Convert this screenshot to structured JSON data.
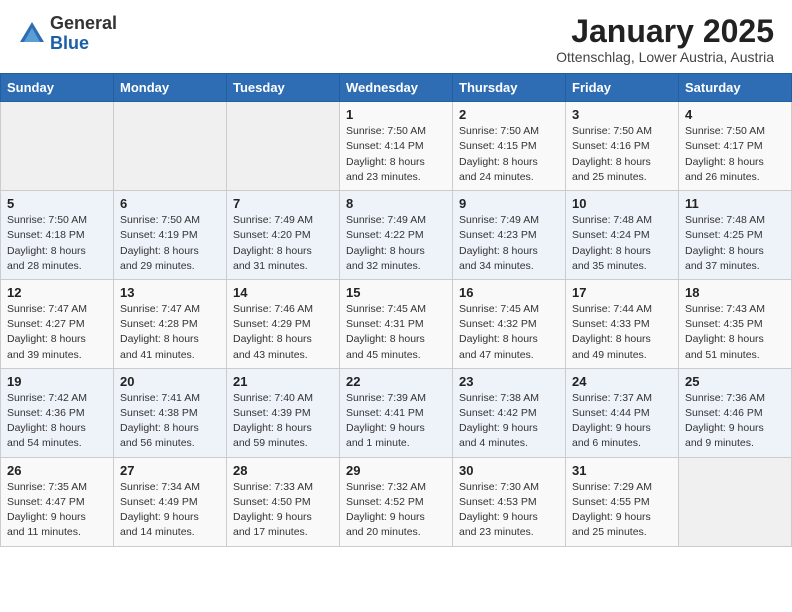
{
  "header": {
    "logo_general": "General",
    "logo_blue": "Blue",
    "month_title": "January 2025",
    "subtitle": "Ottenschlag, Lower Austria, Austria"
  },
  "days_of_week": [
    "Sunday",
    "Monday",
    "Tuesday",
    "Wednesday",
    "Thursday",
    "Friday",
    "Saturday"
  ],
  "weeks": [
    [
      {
        "day": "",
        "info": ""
      },
      {
        "day": "",
        "info": ""
      },
      {
        "day": "",
        "info": ""
      },
      {
        "day": "1",
        "info": "Sunrise: 7:50 AM\nSunset: 4:14 PM\nDaylight: 8 hours\nand 23 minutes."
      },
      {
        "day": "2",
        "info": "Sunrise: 7:50 AM\nSunset: 4:15 PM\nDaylight: 8 hours\nand 24 minutes."
      },
      {
        "day": "3",
        "info": "Sunrise: 7:50 AM\nSunset: 4:16 PM\nDaylight: 8 hours\nand 25 minutes."
      },
      {
        "day": "4",
        "info": "Sunrise: 7:50 AM\nSunset: 4:17 PM\nDaylight: 8 hours\nand 26 minutes."
      }
    ],
    [
      {
        "day": "5",
        "info": "Sunrise: 7:50 AM\nSunset: 4:18 PM\nDaylight: 8 hours\nand 28 minutes."
      },
      {
        "day": "6",
        "info": "Sunrise: 7:50 AM\nSunset: 4:19 PM\nDaylight: 8 hours\nand 29 minutes."
      },
      {
        "day": "7",
        "info": "Sunrise: 7:49 AM\nSunset: 4:20 PM\nDaylight: 8 hours\nand 31 minutes."
      },
      {
        "day": "8",
        "info": "Sunrise: 7:49 AM\nSunset: 4:22 PM\nDaylight: 8 hours\nand 32 minutes."
      },
      {
        "day": "9",
        "info": "Sunrise: 7:49 AM\nSunset: 4:23 PM\nDaylight: 8 hours\nand 34 minutes."
      },
      {
        "day": "10",
        "info": "Sunrise: 7:48 AM\nSunset: 4:24 PM\nDaylight: 8 hours\nand 35 minutes."
      },
      {
        "day": "11",
        "info": "Sunrise: 7:48 AM\nSunset: 4:25 PM\nDaylight: 8 hours\nand 37 minutes."
      }
    ],
    [
      {
        "day": "12",
        "info": "Sunrise: 7:47 AM\nSunset: 4:27 PM\nDaylight: 8 hours\nand 39 minutes."
      },
      {
        "day": "13",
        "info": "Sunrise: 7:47 AM\nSunset: 4:28 PM\nDaylight: 8 hours\nand 41 minutes."
      },
      {
        "day": "14",
        "info": "Sunrise: 7:46 AM\nSunset: 4:29 PM\nDaylight: 8 hours\nand 43 minutes."
      },
      {
        "day": "15",
        "info": "Sunrise: 7:45 AM\nSunset: 4:31 PM\nDaylight: 8 hours\nand 45 minutes."
      },
      {
        "day": "16",
        "info": "Sunrise: 7:45 AM\nSunset: 4:32 PM\nDaylight: 8 hours\nand 47 minutes."
      },
      {
        "day": "17",
        "info": "Sunrise: 7:44 AM\nSunset: 4:33 PM\nDaylight: 8 hours\nand 49 minutes."
      },
      {
        "day": "18",
        "info": "Sunrise: 7:43 AM\nSunset: 4:35 PM\nDaylight: 8 hours\nand 51 minutes."
      }
    ],
    [
      {
        "day": "19",
        "info": "Sunrise: 7:42 AM\nSunset: 4:36 PM\nDaylight: 8 hours\nand 54 minutes."
      },
      {
        "day": "20",
        "info": "Sunrise: 7:41 AM\nSunset: 4:38 PM\nDaylight: 8 hours\nand 56 minutes."
      },
      {
        "day": "21",
        "info": "Sunrise: 7:40 AM\nSunset: 4:39 PM\nDaylight: 8 hours\nand 59 minutes."
      },
      {
        "day": "22",
        "info": "Sunrise: 7:39 AM\nSunset: 4:41 PM\nDaylight: 9 hours\nand 1 minute."
      },
      {
        "day": "23",
        "info": "Sunrise: 7:38 AM\nSunset: 4:42 PM\nDaylight: 9 hours\nand 4 minutes."
      },
      {
        "day": "24",
        "info": "Sunrise: 7:37 AM\nSunset: 4:44 PM\nDaylight: 9 hours\nand 6 minutes."
      },
      {
        "day": "25",
        "info": "Sunrise: 7:36 AM\nSunset: 4:46 PM\nDaylight: 9 hours\nand 9 minutes."
      }
    ],
    [
      {
        "day": "26",
        "info": "Sunrise: 7:35 AM\nSunset: 4:47 PM\nDaylight: 9 hours\nand 11 minutes."
      },
      {
        "day": "27",
        "info": "Sunrise: 7:34 AM\nSunset: 4:49 PM\nDaylight: 9 hours\nand 14 minutes."
      },
      {
        "day": "28",
        "info": "Sunrise: 7:33 AM\nSunset: 4:50 PM\nDaylight: 9 hours\nand 17 minutes."
      },
      {
        "day": "29",
        "info": "Sunrise: 7:32 AM\nSunset: 4:52 PM\nDaylight: 9 hours\nand 20 minutes."
      },
      {
        "day": "30",
        "info": "Sunrise: 7:30 AM\nSunset: 4:53 PM\nDaylight: 9 hours\nand 23 minutes."
      },
      {
        "day": "31",
        "info": "Sunrise: 7:29 AM\nSunset: 4:55 PM\nDaylight: 9 hours\nand 25 minutes."
      },
      {
        "day": "",
        "info": ""
      }
    ]
  ]
}
